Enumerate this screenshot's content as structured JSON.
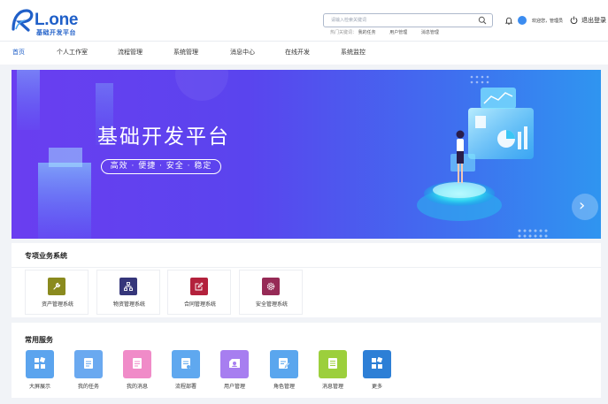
{
  "brand": {
    "name": "L.one",
    "subtitle": "基础开发平台",
    "color": "#1f5fc8"
  },
  "search": {
    "placeholder": "请输入检索关键词",
    "hot_label": "热门关键词：",
    "hot_words": [
      "我的任务",
      "用户管理",
      "消息管理"
    ]
  },
  "user": {
    "welcome": "欢迎您，管理员",
    "logout": "退出登录"
  },
  "nav": {
    "items": [
      "首页",
      "个人工作室",
      "流程管理",
      "系统管理",
      "消息中心",
      "在线开发",
      "系统监控"
    ],
    "active_index": 0
  },
  "banner": {
    "title": "基础开发平台",
    "tagline": "高效 · 便捷 · 安全 · 稳定",
    "next_glyph": "›"
  },
  "business_systems": {
    "title": "专项业务系统",
    "items": [
      {
        "label": "资产管理系统",
        "icon": "wrench-icon",
        "color": "#8a8a1e"
      },
      {
        "label": "物资管理系统",
        "icon": "sitemap-icon",
        "color": "#35367a"
      },
      {
        "label": "合同管理系统",
        "icon": "edit-icon",
        "color": "#b3213c"
      },
      {
        "label": "安全管理系统",
        "icon": "gear-icon",
        "color": "#962a56"
      }
    ]
  },
  "services": {
    "title": "常用服务",
    "items": [
      {
        "label": "大屏展示",
        "icon": "dashboard-icon",
        "color": "#5ba4ee"
      },
      {
        "label": "我的任务",
        "icon": "task-list-icon",
        "color": "#6aa9f0"
      },
      {
        "label": "我的消息",
        "icon": "message-doc-icon",
        "color": "#f08bc8"
      },
      {
        "label": "流程部署",
        "icon": "process-doc-icon",
        "color": "#5fa8ef"
      },
      {
        "label": "用户管理",
        "icon": "user-manage-icon",
        "color": "#a77ef0"
      },
      {
        "label": "角色管理",
        "icon": "role-edit-icon",
        "color": "#5aa6ee"
      },
      {
        "label": "消息管理",
        "icon": "message-manage-icon",
        "color": "#9ccf3c"
      },
      {
        "label": "更多",
        "icon": "grid-more-icon",
        "color": "#2d7fd6"
      }
    ]
  }
}
